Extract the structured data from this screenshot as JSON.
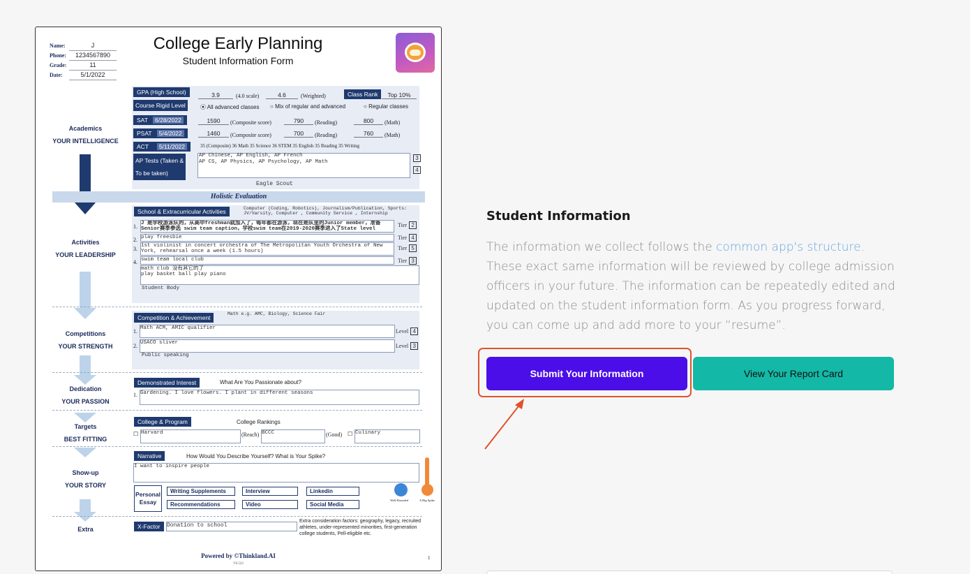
{
  "form": {
    "title": "College Early Planning",
    "subtitle": "Student Information Form",
    "header_fields": [
      {
        "label": "Name:",
        "value": "J"
      },
      {
        "label": "Phone:",
        "value": "1234567890"
      },
      {
        "label": "Grade:",
        "value": "11"
      },
      {
        "label": "Date:",
        "value": "5/1/2022"
      }
    ],
    "sections": {
      "academics": {
        "name": "Academics",
        "tagline": "YOUR INTELLIGENCE"
      },
      "activities": {
        "name": "Activities",
        "tagline": "YOUR LEADERSHIP"
      },
      "competitions": {
        "name": "Competitions",
        "tagline": "YOUR STRENGTH"
      },
      "dedication": {
        "name": "Dedication",
        "tagline": "YOUR PASSION"
      },
      "targets": {
        "name": "Targets",
        "tagline": "BEST FITTING"
      },
      "showup": {
        "name": "Show-up",
        "tagline": "YOUR STORY"
      },
      "extra": {
        "name": "Extra"
      }
    },
    "academics": {
      "gpa_label": "GPA (High School)",
      "gpa": "3.9",
      "gpa_scale": "(4.0 scale)",
      "gpa_weighted": "4.6",
      "weighted_label": "(Weighted)",
      "class_rank_label": "Class Rank",
      "class_rank": "Top 10%",
      "course_label": "Course Rigid Level",
      "course_opt1": "All advanced classes",
      "course_opt2": "Mix of regular and advanced",
      "course_opt3": "Regular classes",
      "sat_label": "SAT",
      "sat_date": "6/28/2022",
      "sat_total": "1590",
      "sat_reading": "790",
      "sat_math": "800",
      "psat_label": "PSAT",
      "psat_date": "5/4/2022",
      "psat_total": "1460",
      "psat_reading": "700",
      "psat_math": "760",
      "composite_label": "(Composite score)",
      "reading_label": "(Reading)",
      "math_label": "(Math)",
      "act_label": "ACT",
      "act_date": "5/11/2022",
      "act_line": "35 (Composite) 36 Math 35 Science 36 STEM 35 English 35 Reading 35 Writing",
      "ap_label_1": "AP Tests (Taken &",
      "ap_label_2": "To be taken)",
      "ap_line1": "AP Chinese, AP English, AP French",
      "ap_line2": "AP CS, AP Physics, AP Psychology, AP Math",
      "ap_count1": "3",
      "ap_count2": "4",
      "extra_note": "Eagle Scout"
    },
    "holistic": "Holistic Evaluation",
    "activities": {
      "tag": "School & Extracurricular Activities",
      "hint": "Computer (Coding, Robotics), Journalism/Publication, Sports: JV/Varsity, Computer , Community Service , Internship",
      "items": [
        {
          "n": "1.",
          "text": "J 是学校游泳队的，从高中freshman就加入了，每年都在游泳，现在是队里的Junior member，准备 Senior赛季参选 swim team caption，学校swim team在2019-2020赛季进入了State level",
          "tier": "2"
        },
        {
          "n": "2.",
          "text": "play freesbie",
          "tier": "4"
        },
        {
          "n": "3.",
          "text": "1st violinist in concert orchestra of The Metropolitan Youth Orchestra of New York, rehearsal once a week  (1.5 hours)",
          "tier": "5"
        },
        {
          "n": "4.",
          "text": "swim team local club",
          "tier": "3"
        }
      ],
      "tier_label": "Tier",
      "more": "math club 没有其它的了\nplay basket ball play piano",
      "more2": "Student Body"
    },
    "competitions": {
      "tag": "Competition & Achievement",
      "hint": "Math e.g. AMC, Biology, Science Fair",
      "items": [
        {
          "n": "1.",
          "text": "Math ACM, AMIC qualifier",
          "level": "4"
        },
        {
          "n": "2.",
          "text": "USACO sliver",
          "level": "3"
        }
      ],
      "level_label": "Level",
      "more": "Public speaking"
    },
    "dedication": {
      "tag": "Demonstrated Interest",
      "question": "What Are You Passionate about?",
      "n": "1.",
      "answer": "Gardening. I love flowers. I plant in different seasons"
    },
    "targets": {
      "tag": "College & Program",
      "rankings": "College Rankings",
      "reach_school": "Harvard",
      "reach_label": "(Reach)",
      "good_school": "BCCC",
      "good_label": "(Good)",
      "other": "Culinary"
    },
    "narrative": {
      "tag": "Narrative",
      "question": "How Would You Describe Yourself? What is Your Spike?",
      "answer": "I want to inspire people",
      "personal_essay": "Personal Essay",
      "buttons": [
        "Writing Supplements",
        "Interview",
        "Linkedin",
        "Recommendations",
        "Video",
        "Social Media"
      ],
      "well_rounded": "Well-Rounded",
      "big_spike": "A Big Spike"
    },
    "xfactor": {
      "tag": "X-Factor",
      "answer": "Donation to school",
      "note": "Extra consideration factors: geography, legacy, recruited athletes, under-represented minorities, first-generation college students, Pell-eligible etc."
    },
    "footer": "Powered by ©Thinkland.AI",
    "version": "V6.522",
    "page_number": "1"
  },
  "info": {
    "title": "Student Information",
    "body_before": "The information we collect follows the ",
    "link_text": "common app's structure",
    "body_after": ". These exact same information will be reviewed by college admission officers in your future. The information can be repeatedly edited and updated on the student information form. As you progress forward, you can come up and add more to your “resume”."
  },
  "actions": {
    "submit_label": "Submit Your Information",
    "report_label": "View Your Report Card"
  },
  "colors": {
    "submit_bg": "#4b0ee8",
    "report_bg": "#14b8a6",
    "highlight": "#e0532b",
    "link": "#6aa6da",
    "form_navy": "#1f3a6e"
  }
}
